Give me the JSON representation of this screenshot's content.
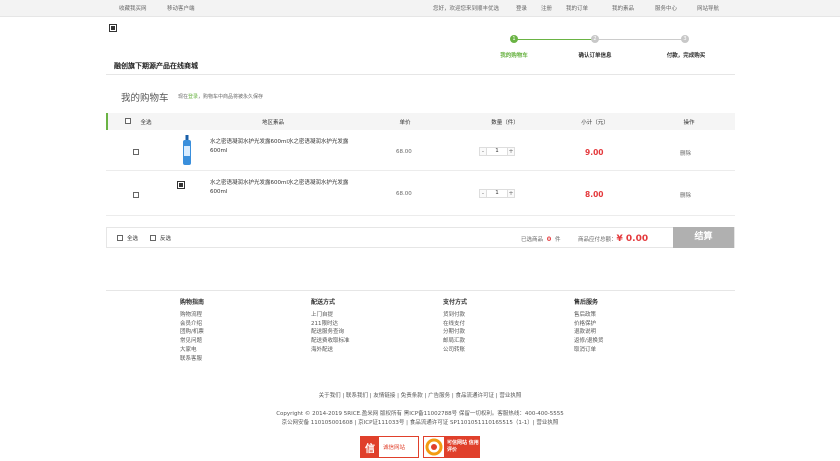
{
  "topbar": {
    "left": [
      "收藏我买网",
      "移动客户端"
    ],
    "greeting": "您好，欢迎您来到顺丰优选",
    "right": [
      "登录",
      "注册",
      "我的订单",
      "我的素品",
      "服务中心",
      "网站导航"
    ]
  },
  "header": {
    "slogan": "融创旗下期源产品在线商城",
    "steps": [
      {
        "num": "1",
        "label": "我的购物车",
        "active": true
      },
      {
        "num": "2",
        "label": "确认订单信息",
        "active": false
      },
      {
        "num": "3",
        "label": "付款，完成购买",
        "active": false
      }
    ]
  },
  "cart": {
    "title": "我的购物车",
    "note_prefix": "现在",
    "note_link": "登录",
    "note_suffix": "，购物车中商品将被永久保存",
    "columns": {
      "select_all": "全选",
      "product": "地区素品",
      "price": "单价",
      "qty": "数量（件）",
      "subtotal": "小计（元）",
      "ops": "操作"
    },
    "items": [
      {
        "name": "水之密语凝润水护光发露600ml水之密语凝润水护光发露600ml",
        "price": "68.00",
        "qty": "1",
        "subtotal": "9.00",
        "op": "删除"
      },
      {
        "name": "水之密语凝润水护光发露600ml水之密语凝润水护光发露600ml",
        "price": "68.00",
        "qty": "1",
        "subtotal": "8.00",
        "op": "删除"
      }
    ],
    "qty_minus": "-",
    "qty_plus": "+"
  },
  "summary": {
    "select_all": "全选",
    "invert": "反选",
    "selected_label": "已选商品",
    "selected_count": "0",
    "selected_unit": "件",
    "total_label": "商品应付总额：",
    "total_value": "¥ 0.00",
    "pay_button": "结算"
  },
  "footer": {
    "columns": [
      {
        "title": "购物指南",
        "links": [
          "购物流程",
          "会员介绍",
          "团购/机票",
          "常见问题",
          "大家电",
          "联系客服"
        ]
      },
      {
        "title": "配送方式",
        "links": [
          "上门自提",
          "211限时达",
          "配送服务查询",
          "配送费收取标准",
          "海外配送"
        ]
      },
      {
        "title": "支付方式",
        "links": [
          "货到付款",
          "在线支付",
          "分期付款",
          "邮局汇款",
          "公司转账"
        ]
      },
      {
        "title": "售后服务",
        "links": [
          "售后政策",
          "价格保护",
          "退款说明",
          "返修/退换货",
          "取消订单"
        ]
      }
    ],
    "links": [
      "关于我们",
      "联系我们",
      "友情链接",
      "免责条款",
      "广告服务",
      "食品流通许可证",
      "营业执照"
    ],
    "copyright1": "Copyright © 2014-2019 5RICE.盈米网 版权所有 黑ICP备11002788号 保留一切权利。客服热线：400-400-5555",
    "copyright2": "京公网安备 110105001608 | 京ICP证111033号 | 食品流通许可证 SP1101051110165515（1-1）| 营业执照",
    "badges": [
      {
        "text": "诚信网站",
        "icon": "credit-icon"
      },
      {
        "text": "可信网站 信用评价",
        "icon": "trusted-site-icon"
      }
    ]
  },
  "colors": {
    "accent": "#6ab344",
    "price": "#e4393c",
    "pay_button": "#b0b0b0"
  }
}
